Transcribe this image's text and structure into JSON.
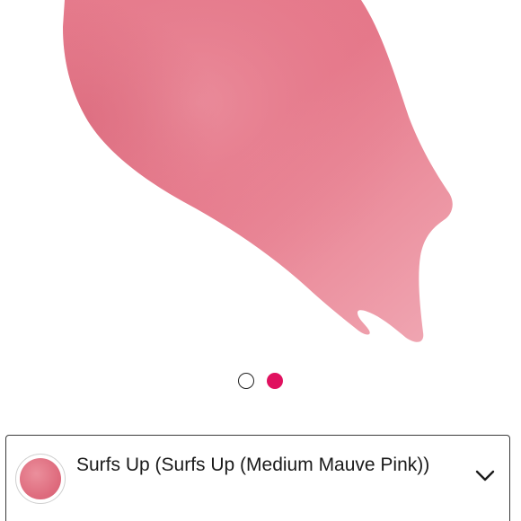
{
  "carousel": {
    "slide_count": 2,
    "active_index": 1,
    "active_color": "#e0115f"
  },
  "product_image": {
    "subject": "lip gloss swatch smear",
    "colors": {
      "light": "#f0a4b0",
      "main": "#e57d8d",
      "deep": "#d86878"
    }
  },
  "shade_selector": {
    "swatch_color": "#de6b7d",
    "label": "Surfs Up (Surfs Up (Medium Mauve Pink))",
    "expand_icon": "chevron-down-icon"
  }
}
